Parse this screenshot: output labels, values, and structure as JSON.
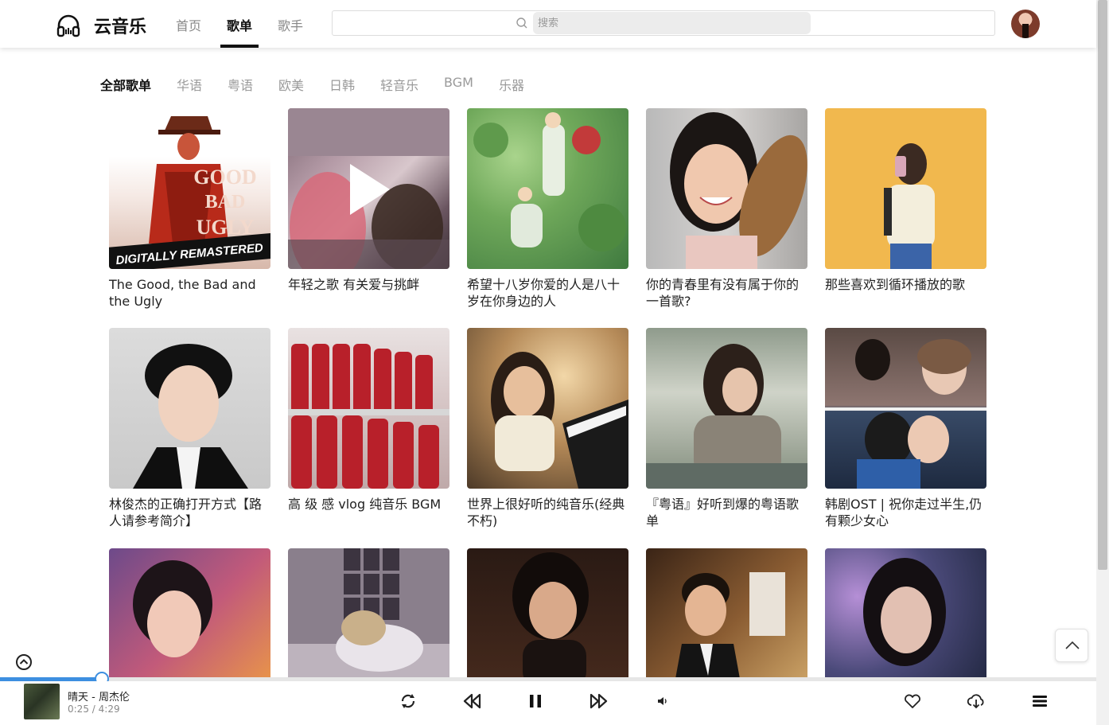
{
  "brand": {
    "name": "云音乐"
  },
  "nav": [
    {
      "label": "首页",
      "active": false
    },
    {
      "label": "歌单",
      "active": true
    },
    {
      "label": "歌手",
      "active": false
    }
  ],
  "search": {
    "placeholder": "搜索",
    "value": ""
  },
  "categories": [
    {
      "label": "全部歌单",
      "active": true
    },
    {
      "label": "华语",
      "active": false
    },
    {
      "label": "粤语",
      "active": false
    },
    {
      "label": "欧美",
      "active": false
    },
    {
      "label": "日韩",
      "active": false
    },
    {
      "label": "轻音乐",
      "active": false
    },
    {
      "label": "BGM",
      "active": false
    },
    {
      "label": "乐器",
      "active": false
    }
  ],
  "playlists": [
    {
      "title": "The Good, the Bad and the Ugly",
      "cover_art_text": "DIGITALLY REMASTERED"
    },
    {
      "title": "年轻之歌 有关爱与挑衅"
    },
    {
      "title": "希望十八岁你爱的人是八十岁在你身边的人"
    },
    {
      "title": "你的青春里有没有属于你的一首歌?"
    },
    {
      "title": "那些喜欢到循环播放的歌"
    },
    {
      "title": "林俊杰的正确打开方式【路人请参考简介】"
    },
    {
      "title": "高 级 感 vlog 纯音乐 BGM"
    },
    {
      "title": "世界上很好听的纯音乐(经典不朽)"
    },
    {
      "title": "『粤语』好听到爆的粤语歌单"
    },
    {
      "title": "韩剧OST | 祝你走过半生,仍有颗少女心"
    },
    {
      "title": ""
    },
    {
      "title": ""
    },
    {
      "title": ""
    },
    {
      "title": ""
    },
    {
      "title": ""
    }
  ],
  "player": {
    "song": "晴天 - 周杰伦",
    "current_time": "0:25",
    "total_time": "4:29",
    "progress": 0.0929,
    "controls": [
      "loop-icon",
      "previous-icon",
      "pause-icon",
      "next-icon",
      "volume-icon"
    ],
    "actions": [
      "heart-icon",
      "download-cloud-icon",
      "playlist-menu-icon"
    ]
  },
  "colors": {
    "accent": "#3d8fe0",
    "active_text": "#111111",
    "muted_text": "#9a9a9a"
  }
}
